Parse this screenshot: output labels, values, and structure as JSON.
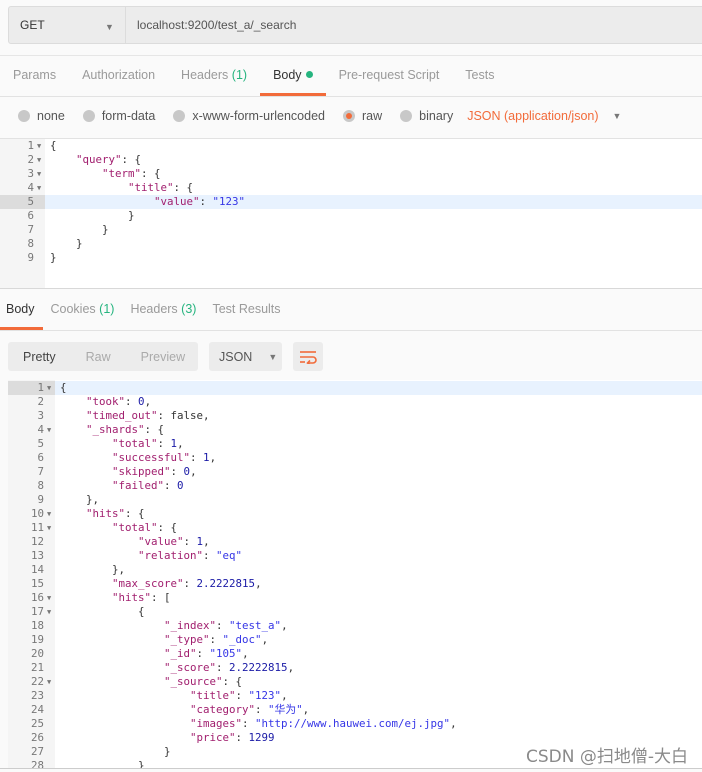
{
  "request": {
    "method": "GET",
    "url": "localhost:9200/test_a/_search",
    "tabs": [
      {
        "label": "Params"
      },
      {
        "label": "Authorization"
      },
      {
        "label": "Headers",
        "count": "(1)"
      },
      {
        "label": "Body",
        "active": true,
        "indicator": "green-dot"
      },
      {
        "label": "Pre-request Script"
      },
      {
        "label": "Tests"
      }
    ],
    "body_modes": [
      "none",
      "form-data",
      "x-www-form-urlencoded",
      "raw",
      "binary"
    ],
    "selected_mode": "raw",
    "content_type": "JSON (application/json)",
    "body_lines": [
      "{",
      "    \"query\": {",
      "        \"term\": {",
      "            \"title\": {",
      "                \"value\": \"123\"",
      "            }",
      "        }",
      "    }",
      "}"
    ],
    "foldable_lines": [
      1,
      2,
      3,
      4
    ],
    "active_line": 5
  },
  "response": {
    "tabs": [
      {
        "label": "Body",
        "active": true
      },
      {
        "label": "Cookies",
        "count": "(1)"
      },
      {
        "label": "Headers",
        "count": "(3)"
      },
      {
        "label": "Test Results"
      }
    ],
    "view_modes": [
      "Pretty",
      "Raw",
      "Preview"
    ],
    "active_view": "Pretty",
    "format": "JSON",
    "wrap_icon": "wrap-lines-icon",
    "body_lines": [
      "{",
      "    \"took\": 0,",
      "    \"timed_out\": false,",
      "    \"_shards\": {",
      "        \"total\": 1,",
      "        \"successful\": 1,",
      "        \"skipped\": 0,",
      "        \"failed\": 0",
      "    },",
      "    \"hits\": {",
      "        \"total\": {",
      "            \"value\": 1,",
      "            \"relation\": \"eq\"",
      "        },",
      "        \"max_score\": 2.2222815,",
      "        \"hits\": [",
      "            {",
      "                \"_index\": \"test_a\",",
      "                \"_type\": \"_doc\",",
      "                \"_id\": \"105\",",
      "                \"_score\": 2.2222815,",
      "                \"_source\": {",
      "                    \"title\": \"123\",",
      "                    \"category\": \"华为\",",
      "                    \"images\": \"http://www.hauwei.com/ej.jpg\",",
      "                    \"price\": 1299",
      "                }",
      "            }"
    ],
    "foldable_lines": [
      1,
      4,
      10,
      11,
      16,
      17,
      22
    ],
    "active_line": 1
  },
  "watermark": "CSDN @扫地僧-大白",
  "colors": {
    "accent": "#f26b3a",
    "green": "#26b47f",
    "key": "#a11e6e",
    "string": "#3535e6",
    "number": "#1a1aa6"
  }
}
